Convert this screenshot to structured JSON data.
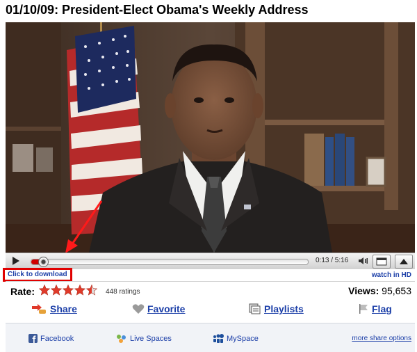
{
  "video": {
    "title": "01/10/09: President-Elect Obama's Weekly Address",
    "current_time": "0:13",
    "duration": "5:16",
    "time_display": "0:13 / 5:16",
    "progress_fraction": 0.041
  },
  "links": {
    "download": "Click to download",
    "hd": "watch in HD"
  },
  "rating": {
    "label": "Rate:",
    "stars": 4.5,
    "count_text": "448 ratings"
  },
  "views": {
    "label": "Views:",
    "value": "95,653"
  },
  "actions": [
    {
      "label": "Share",
      "icon": "share-icon"
    },
    {
      "label": "Favorite",
      "icon": "heart-icon"
    },
    {
      "label": "Playlists",
      "icon": "playlist-icon"
    },
    {
      "label": "Flag",
      "icon": "flag-icon"
    }
  ],
  "share_sites": [
    {
      "label": "Facebook",
      "icon": "facebook-icon"
    },
    {
      "label": "Live Spaces",
      "icon": "live-spaces-icon"
    },
    {
      "label": "MySpace",
      "icon": "myspace-icon"
    }
  ],
  "more_share": "more share options",
  "colors": {
    "link": "#1c3fa8",
    "annotation_red": "#e00000",
    "progress_red": "#d00000",
    "star_red": "#e03a2a"
  }
}
